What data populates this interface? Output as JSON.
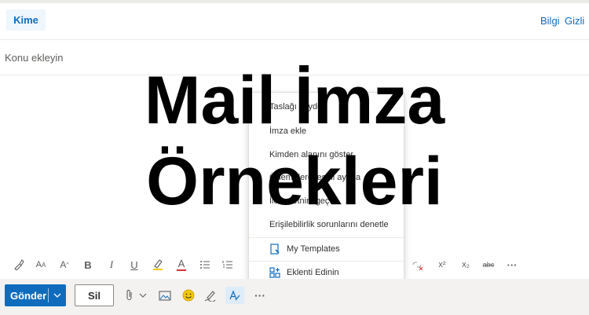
{
  "header": {
    "to_button": "Kime",
    "info_link": "Bilgi",
    "hidden_link": "Gizli"
  },
  "subject": {
    "placeholder": "Konu ekleyin"
  },
  "menu": {
    "items": [
      "Taslağı kaydet",
      "İmza ekle",
      "Kimden alanını göster",
      "Önem derecesini ayarla",
      "İleti metnini geç",
      "Erişilebilirlik sorunlarını denetle"
    ],
    "addins": [
      {
        "label": "My Templates",
        "icon": "templates-icon"
      },
      {
        "label": "Eklenti Edinin",
        "icon": "add-ins-icon"
      }
    ]
  },
  "overlay": {
    "line1": "Mail İmza",
    "line2": "Örnekleri"
  },
  "format_toolbar": {
    "icons": [
      "format-painter-icon",
      "font-size-icon",
      "grow-font-icon",
      "bold-icon",
      "italic-icon",
      "underline-icon",
      "highlight-icon",
      "font-color-icon",
      "bullets-icon",
      "numbering-icon",
      "link-remove-icon",
      "superscript-icon",
      "subscript-icon",
      "strikethrough-icon",
      "more-icon"
    ],
    "glyphs": {
      "bold": "B",
      "italic": "I",
      "underline": "U",
      "font_color": "A",
      "superscript": "x²",
      "subscript": "x₂",
      "strikethrough": "abc",
      "more": "···"
    }
  },
  "bottom_bar": {
    "send_label": "Gönder",
    "discard_label": "Sil",
    "more": "···"
  },
  "colors": {
    "accent": "#0f6cbd",
    "overlay_text": "#000000"
  }
}
